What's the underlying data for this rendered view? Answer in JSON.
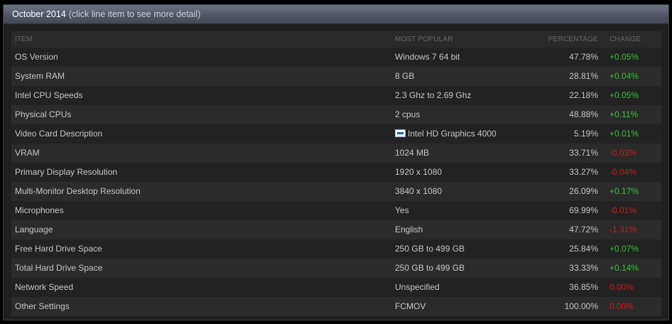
{
  "header": {
    "title": "October 2014",
    "subtitle": "(click line item to see more detail)"
  },
  "columns": {
    "item": "ITEM",
    "most_popular": "MOST POPULAR",
    "percentage": "PERCENTAGE",
    "change": "CHANGE"
  },
  "colors": {
    "positive_change": "#34c134",
    "negative_change": "#d01a1a"
  },
  "rows": [
    {
      "item": "OS Version",
      "most_popular": "Windows 7 64 bit",
      "percentage": "47.78%",
      "change": "+0.05%"
    },
    {
      "item": "System RAM",
      "most_popular": "8 GB",
      "percentage": "28.81%",
      "change": "+0.04%"
    },
    {
      "item": "Intel CPU Speeds",
      "most_popular": "2.3 Ghz to 2.69 Ghz",
      "percentage": "22.18%",
      "change": "+0.05%"
    },
    {
      "item": "Physical CPUs",
      "most_popular": "2 cpus",
      "percentage": "48.88%",
      "change": "+0.11%"
    },
    {
      "item": "Video Card Description",
      "most_popular": "Intel HD Graphics 4000",
      "percentage": "5.19%",
      "change": "+0.01%",
      "icon": "intel-logo-icon"
    },
    {
      "item": "VRAM",
      "most_popular": "1024 MB",
      "percentage": "33.71%",
      "change": "-0.03%"
    },
    {
      "item": "Primary Display Resolution",
      "most_popular": "1920 x 1080",
      "percentage": "33.27%",
      "change": "-0.04%"
    },
    {
      "item": "Multi-Monitor Desktop Resolution",
      "most_popular": "3840 x 1080",
      "percentage": "26.09%",
      "change": "+0.17%"
    },
    {
      "item": "Microphones",
      "most_popular": "Yes",
      "percentage": "69.99%",
      "change": "-0.01%"
    },
    {
      "item": "Language",
      "most_popular": "English",
      "percentage": "47.72%",
      "change": "-1.31%"
    },
    {
      "item": "Free Hard Drive Space",
      "most_popular": "250 GB to 499 GB",
      "percentage": "25.84%",
      "change": "+0.07%"
    },
    {
      "item": "Total Hard Drive Space",
      "most_popular": "250 GB to 499 GB",
      "percentage": "33.33%",
      "change": "+0.14%"
    },
    {
      "item": "Network Speed",
      "most_popular": "Unspecified",
      "percentage": "36.85%",
      "change": "0.00%"
    },
    {
      "item": "Other Settings",
      "most_popular": "FCMOV",
      "percentage": "100.00%",
      "change": "0.00%"
    }
  ]
}
